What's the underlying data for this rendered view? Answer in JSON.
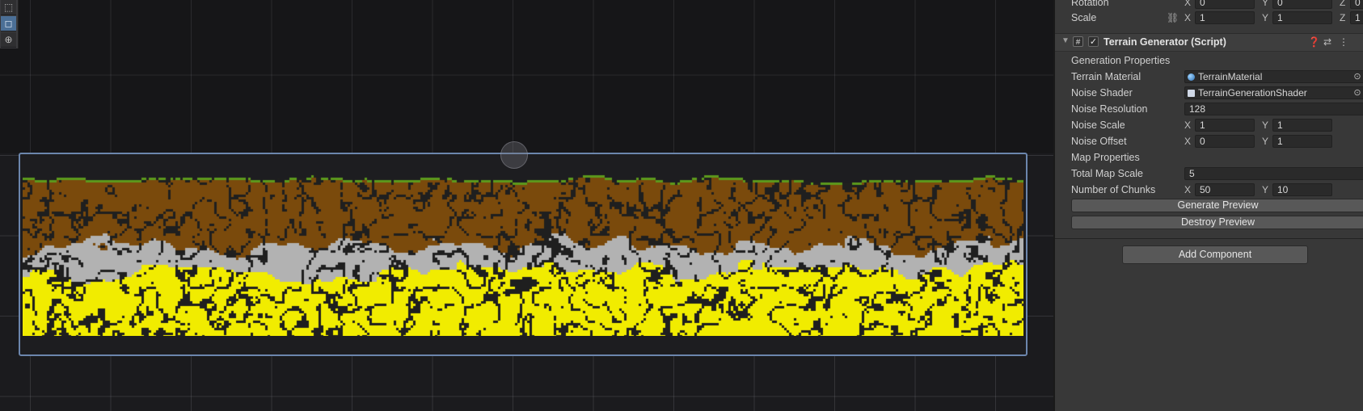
{
  "scene": {
    "tools": [
      {
        "name": "rect-tool",
        "glyph": "⬚"
      },
      {
        "name": "scale-tool",
        "glyph": "◻"
      },
      {
        "name": "transform-tool",
        "glyph": "⊕"
      }
    ],
    "colors": {
      "dirt": "#7a4a0c",
      "stone": "#b2b2b2",
      "gold": "#f1ec00",
      "cave": "#1f1f1f",
      "grass": "#5c9a1c",
      "selection": "#6c86ad"
    }
  },
  "inspector": {
    "transform": {
      "rotation_label": "Rotation",
      "rotation": {
        "x_label": "X",
        "x": "0",
        "y_label": "Y",
        "y": "0",
        "z_label": "Z",
        "z": "0"
      },
      "scale_label": "Scale",
      "scale": {
        "x_label": "X",
        "x": "1",
        "y_label": "Y",
        "y": "1",
        "z_label": "Z",
        "z": "1"
      }
    },
    "component": {
      "title": "Terrain Generator (Script)",
      "enabled": true,
      "generation_section": "Generation Properties",
      "terrain_material_label": "Terrain Material",
      "terrain_material_value": "TerrainMaterial",
      "noise_shader_label": "Noise Shader",
      "noise_shader_value": "TerrainGenerationShader",
      "noise_resolution_label": "Noise Resolution",
      "noise_resolution_value": "128",
      "noise_scale_label": "Noise Scale",
      "noise_scale": {
        "x_label": "X",
        "x": "1",
        "y_label": "Y",
        "y": "1"
      },
      "noise_offset_label": "Noise Offset",
      "noise_offset": {
        "x_label": "X",
        "x": "0",
        "y_label": "Y",
        "y": "1"
      },
      "map_section": "Map Properties",
      "total_map_scale_label": "Total Map Scale",
      "total_map_scale_value": "5",
      "chunks_label": "Number of Chunks",
      "chunks": {
        "x_label": "X",
        "x": "50",
        "y_label": "Y",
        "y": "10"
      },
      "generate_button": "Generate Preview",
      "destroy_button": "Destroy Preview"
    },
    "add_component_button": "Add Component"
  }
}
